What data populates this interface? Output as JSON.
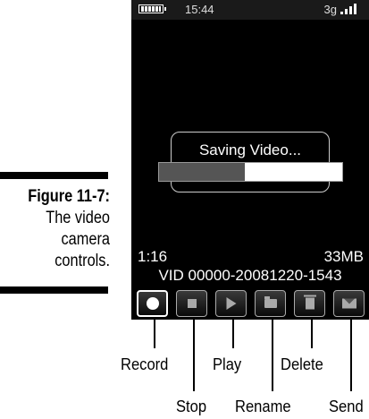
{
  "caption": {
    "figure": "Figure 11-7:",
    "lines": [
      "The video",
      "camera",
      "controls."
    ]
  },
  "status_bar": {
    "time": "15:44",
    "network": "3g"
  },
  "dialog": {
    "title": "Saving Video...",
    "progress_label": "47%",
    "progress_percent": 47
  },
  "info": {
    "duration": "1:16",
    "size": "33MB",
    "filename": "VID 00000-20081220-1543"
  },
  "toolbar": {
    "buttons": [
      {
        "name": "Record",
        "icon": "record-icon"
      },
      {
        "name": "Stop",
        "icon": "stop-icon"
      },
      {
        "name": "Play",
        "icon": "play-icon"
      },
      {
        "name": "Rename",
        "icon": "folder-icon"
      },
      {
        "name": "Delete",
        "icon": "trash-icon"
      },
      {
        "name": "Send",
        "icon": "mail-icon"
      }
    ]
  },
  "callouts": {
    "record": "Record",
    "stop": "Stop",
    "play": "Play",
    "rename": "Rename",
    "delete": "Delete",
    "send": "Send"
  }
}
